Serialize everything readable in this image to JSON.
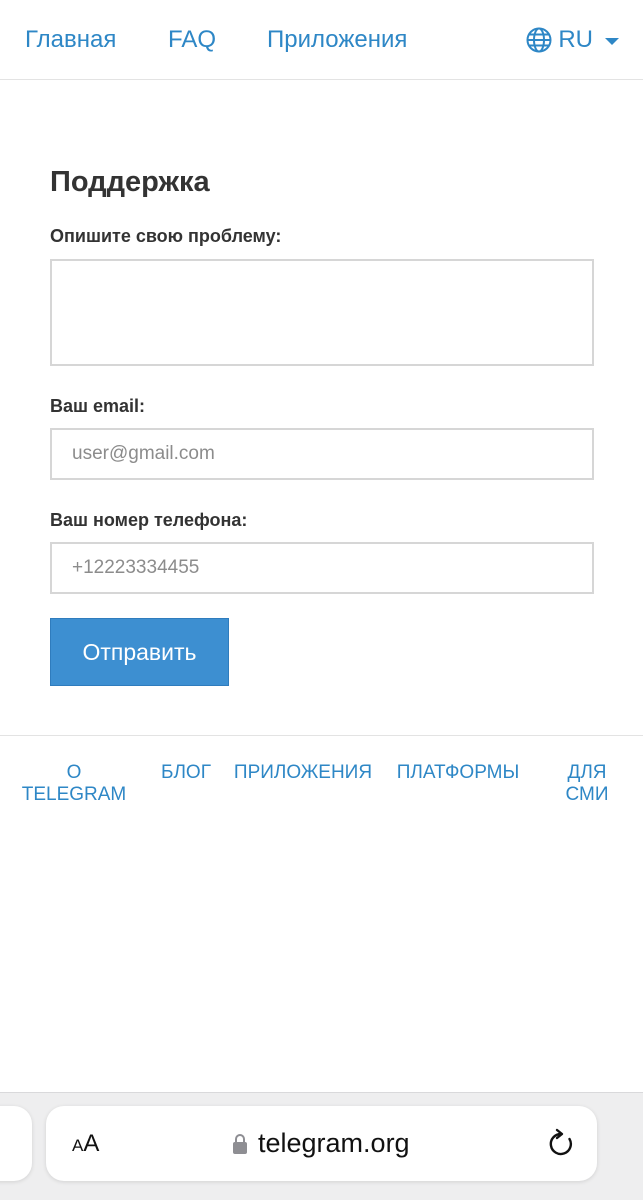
{
  "nav": {
    "home": "Главная",
    "faq": "FAQ",
    "apps": "Приложения",
    "lang": "RU",
    "lang_icon": "globe-icon"
  },
  "form": {
    "title": "Поддержка",
    "problem_label": "Опишите свою проблему:",
    "email_label": "Ваш email:",
    "email_placeholder": "user@gmail.com",
    "phone_label": "Ваш номер телефона:",
    "phone_placeholder": "+12223334455",
    "submit": "Отправить"
  },
  "footer": {
    "about": "О TELEGRAM",
    "blog": "БЛОГ",
    "apps": "ПРИЛОЖЕНИЯ",
    "platforms": "ПЛАТФОРМЫ",
    "press": "ДЛЯ СМИ"
  },
  "browser": {
    "text_size_small": "A",
    "text_size_big": "A",
    "url": "telegram.org",
    "lock_icon": "lock-icon",
    "reload_icon": "reload-icon"
  },
  "colors": {
    "link": "#2e87c6",
    "button": "#3d8fd1",
    "text": "#333333"
  }
}
